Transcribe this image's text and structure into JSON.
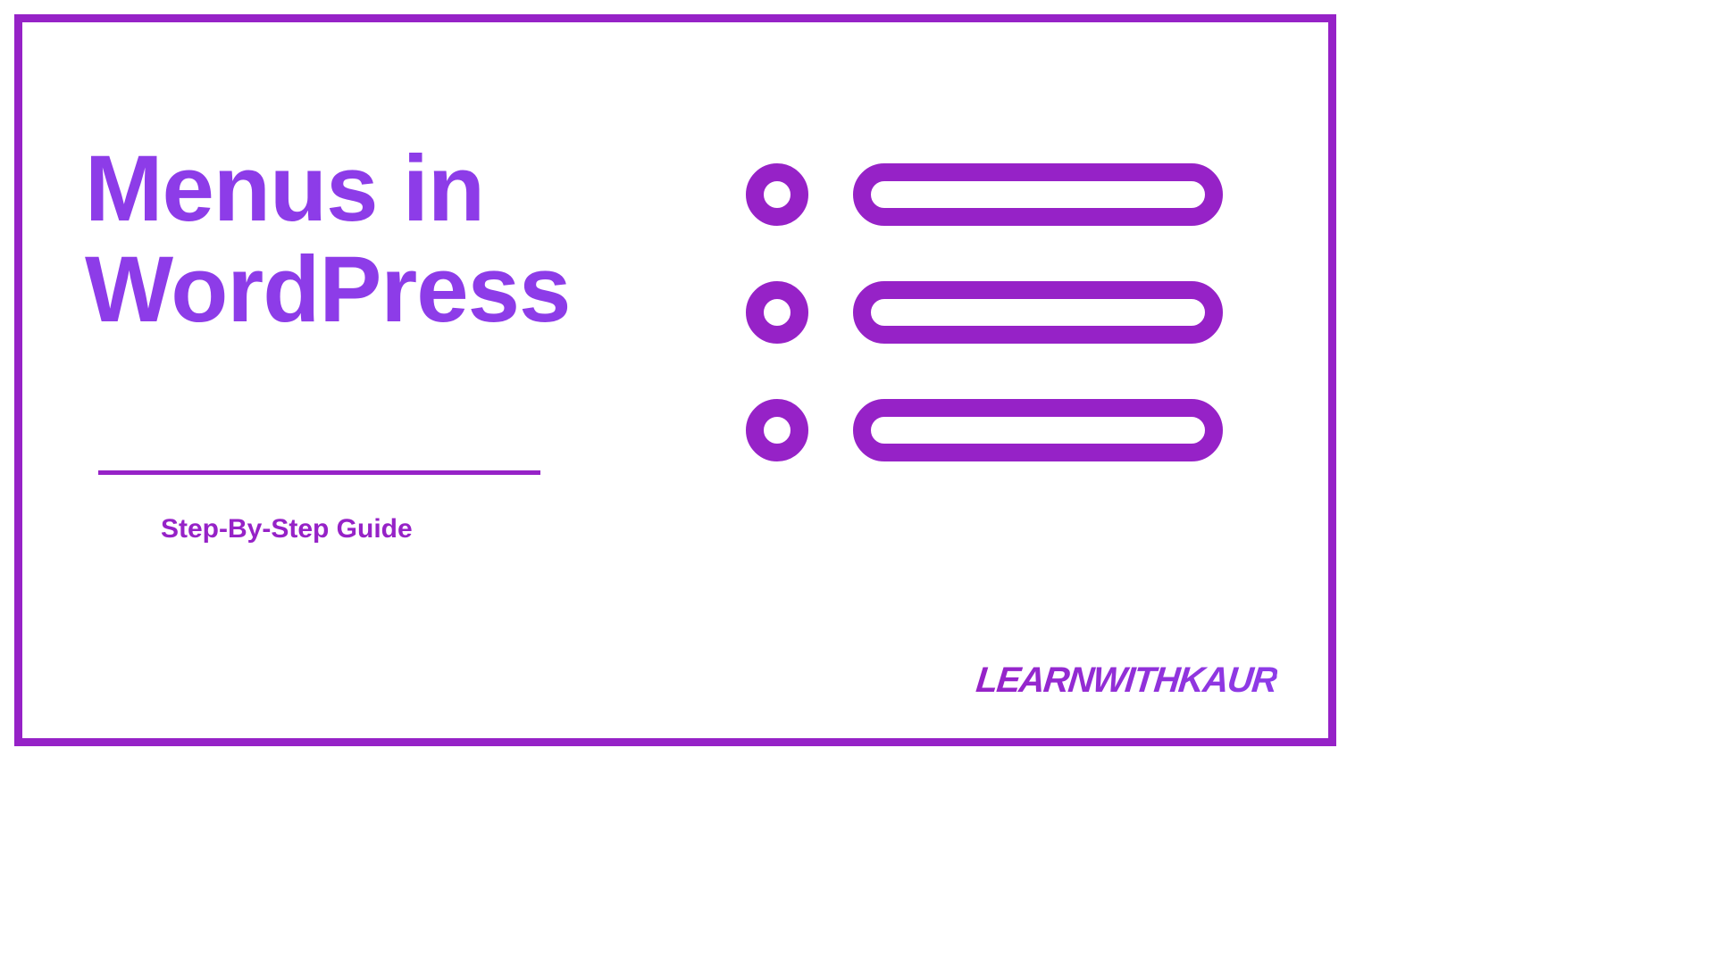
{
  "title": "Menus in\nWordPress",
  "subtitle": "Step-By-Step Guide",
  "brand": "LEARNWITHKAUR",
  "colors": {
    "primary": "#9622c7",
    "accent": "#8d3ce8"
  }
}
